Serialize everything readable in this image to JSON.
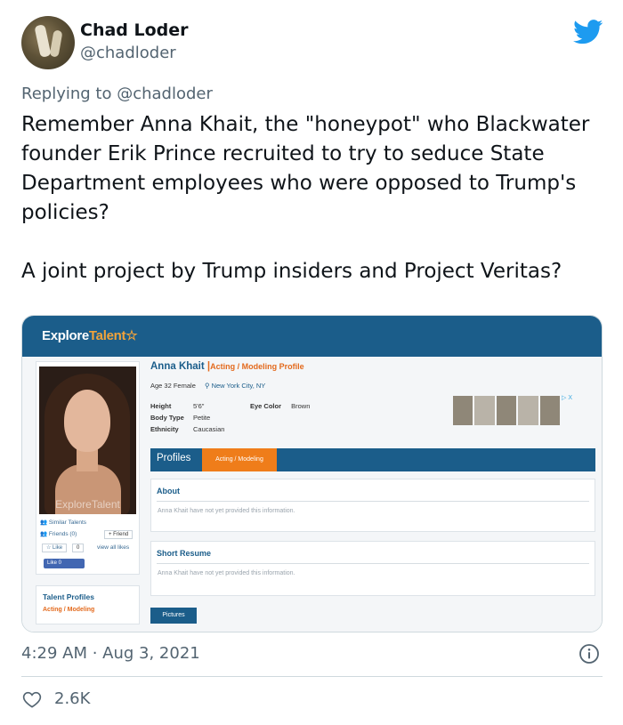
{
  "tweet": {
    "author_name": "Chad Loder",
    "author_handle": "@chadloder",
    "replying_prefix": "Replying to",
    "replying_handle": "@chadloder",
    "paragraph_1": "Remember Anna Khait, the \"honeypot\" who Blackwater founder Erik Prince recruited to try to seduce State Department employees who were opposed to Trump's policies?",
    "paragraph_2": "A joint project by Trump insiders and Project Veritas?",
    "timestamp": "4:29 AM · Aug 3, 2021",
    "likes": "2.6K"
  },
  "screenshot": {
    "logo_explore": "Explore",
    "logo_talent": "Talent",
    "photo_watermark": "ExploreTalent",
    "similar_talents": "Similar Talents",
    "friends": "Friends (0)",
    "add_friend": "+ Friend",
    "like": "☆ Like",
    "like_count": "0",
    "view_all_likes": "view all likes",
    "fb_like": "Like 0",
    "talent_profiles_heading": "Talent Profiles",
    "talent_profiles_item": "Acting / Modeling",
    "profile_name": "Anna Khait",
    "profile_separator": "|",
    "profile_type": "Acting / Modeling Profile",
    "age_gender": "Age 32 Female",
    "location": "New York City, NY",
    "height_label": "Height",
    "height_value": "5'6\"",
    "body_type_label": "Body Type",
    "body_type_value": "Petite",
    "ethnicity_label": "Ethnicity",
    "ethnicity_value": "Caucasian",
    "eye_color_label": "Eye Color",
    "eye_color_value": "Brown",
    "ad_label": "▷ X",
    "tab_profiles": "Profiles",
    "tab_acting": "Acting / Modeling",
    "about_title": "About",
    "about_body": "Anna Khait have not yet provided this information.",
    "resume_title": "Short Resume",
    "resume_body": "Anna Khait have not yet provided this information.",
    "pictures_button": "Pictures"
  },
  "colors": {
    "twitter_blue": "#1d9bf0",
    "et_navy": "#1b5d8a",
    "et_orange": "#ef7d1a"
  }
}
